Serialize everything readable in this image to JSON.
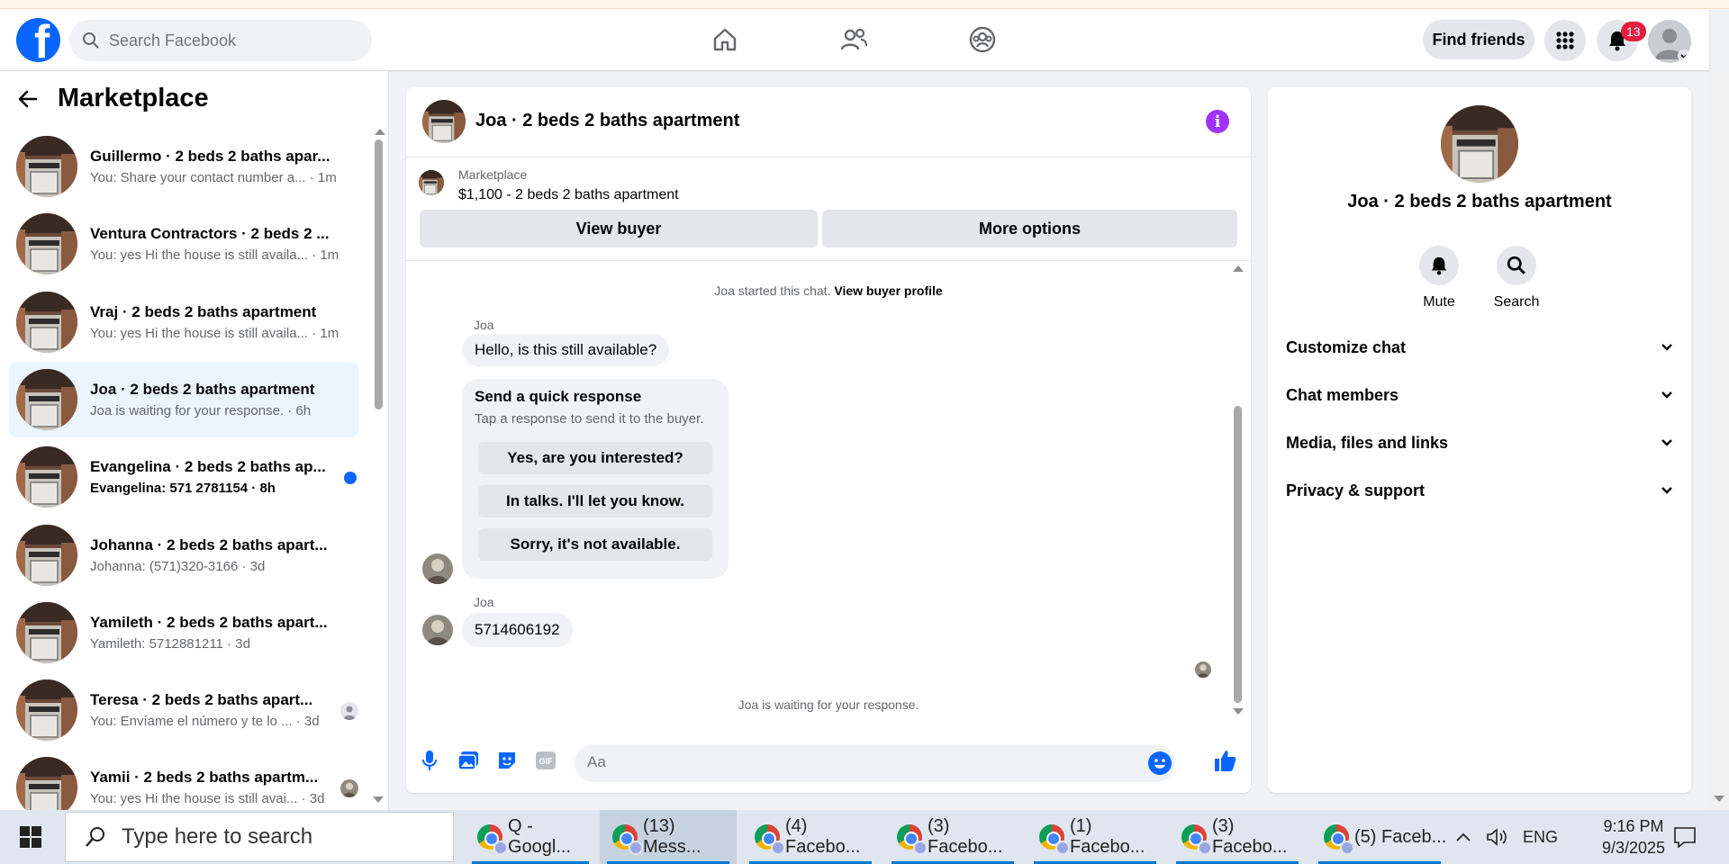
{
  "topbar": {
    "search_placeholder": "Search Facebook",
    "find_friends": "Find friends",
    "notification_count": "13"
  },
  "sidebar": {
    "title": "Marketplace",
    "conversations": [
      {
        "name": "Guillermo · 2 beds 2 baths apar...",
        "preview": "You: Share your contact number a... · 1m"
      },
      {
        "name": "Ventura Contractors · 2 beds 2 ...",
        "preview": "You: yes Hi the house is still availa... · 1m"
      },
      {
        "name": "Vraj · 2 beds 2 baths apartment",
        "preview": "You: yes Hi the house is still availa... · 1m"
      },
      {
        "name": "Joa · 2 beds 2 baths apartment",
        "preview": "Joa is waiting for your response. · 6h"
      },
      {
        "name": "Evangelina · 2 beds 2 baths ap...",
        "preview": "Evangelina: 571 2781154 · 8h"
      },
      {
        "name": "Johanna · 2 beds 2 baths apart...",
        "preview": "Johanna: (571)320-3166 · 3d"
      },
      {
        "name": "Yamileth · 2 beds 2 baths apart...",
        "preview": "Yamileth: 5712881211 · 3d"
      },
      {
        "name": "Teresa · 2 beds 2 baths apart...",
        "preview": "You: Envíame el número y te lo ... · 3d"
      },
      {
        "name": "Yamii · 2 beds 2 baths apartm...",
        "preview": "You: yes Hi the house is still avai... · 3d"
      }
    ]
  },
  "chat": {
    "title": "Joa · 2 beds 2 baths apartment",
    "marketplace_label": "Marketplace",
    "listing": "$1,100 - 2 beds 2 baths apartment",
    "view_buyer": "View buyer",
    "more_options": "More options",
    "started_text": "Joa started this chat.",
    "view_profile": "View buyer profile",
    "sender": "Joa",
    "message1": "Hello, is this still available?",
    "quick_title": "Send a quick response",
    "quick_sub": "Tap a response to send it to the buyer.",
    "quick_options": [
      "Yes, are you interested?",
      "In talks. I'll let you know.",
      "Sorry, it's not available."
    ],
    "message2": "5714606192",
    "waiting": "Joa is waiting for your response.",
    "composer_placeholder": "Aa"
  },
  "details": {
    "name": "Joa · 2 beds 2 baths apartment",
    "mute": "Mute",
    "search": "Search",
    "sections": [
      "Customize chat",
      "Chat members",
      "Media, files and links",
      "Privacy & support"
    ]
  },
  "taskbar": {
    "search_placeholder": "Type here to search",
    "apps": [
      "Q - Googl...",
      "(13) Mess...",
      "(4) Facebo...",
      "(3) Facebo...",
      "(1) Facebo...",
      "(3) Facebo...",
      "(5) Faceb..."
    ],
    "language": "ENG",
    "time": "9:16 PM",
    "date": "9/3/2025"
  }
}
